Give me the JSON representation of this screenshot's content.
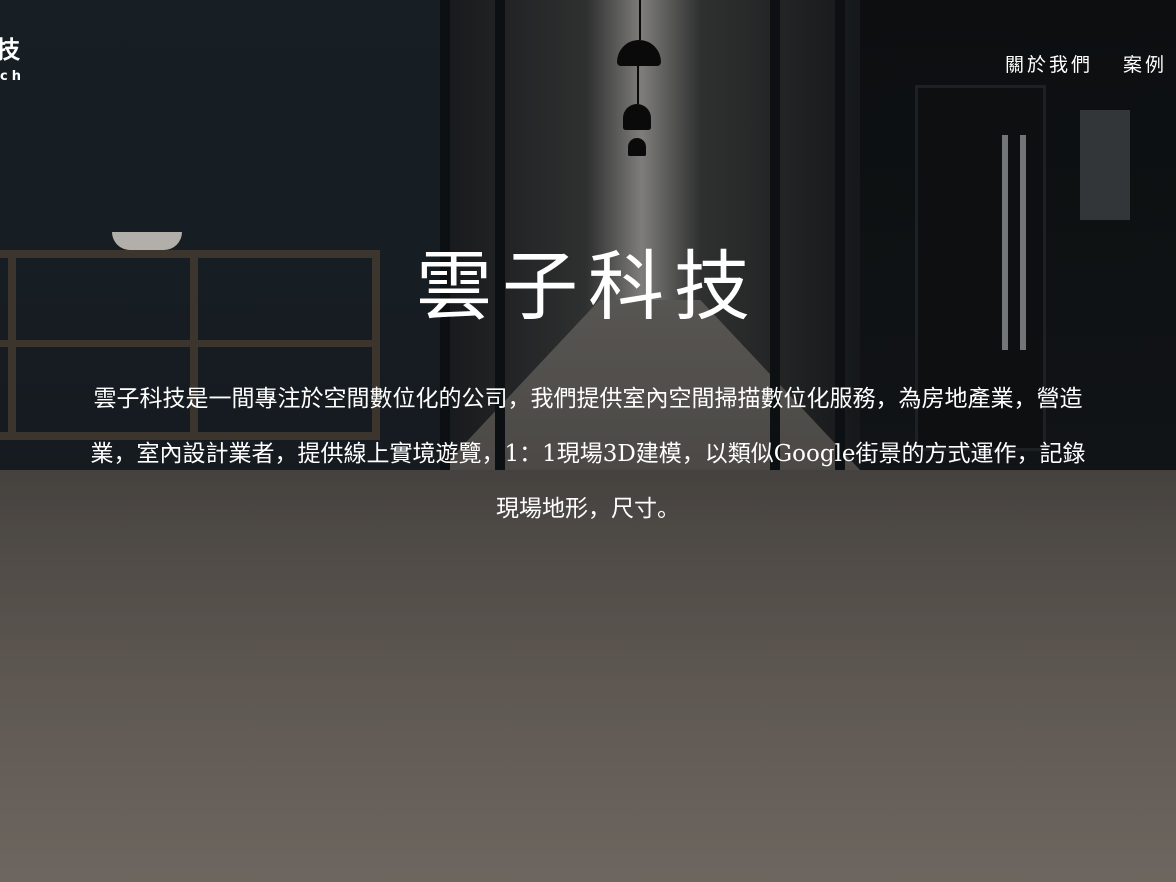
{
  "brand": {
    "name": "技",
    "sub": "ch"
  },
  "nav": {
    "items": [
      {
        "label": "關於我們"
      },
      {
        "label": "案例"
      }
    ]
  },
  "hero": {
    "title": "雲子科技",
    "description": "雲子科技是一間專注於空間數位化的公司，我們提供室內空間掃描數位化服務，為房地產業，營造業，室內設計業者，提供線上實境遊覽，1：1現場3D建模，以類似Google街景的方式運作，記錄現場地形，尺寸。"
  }
}
